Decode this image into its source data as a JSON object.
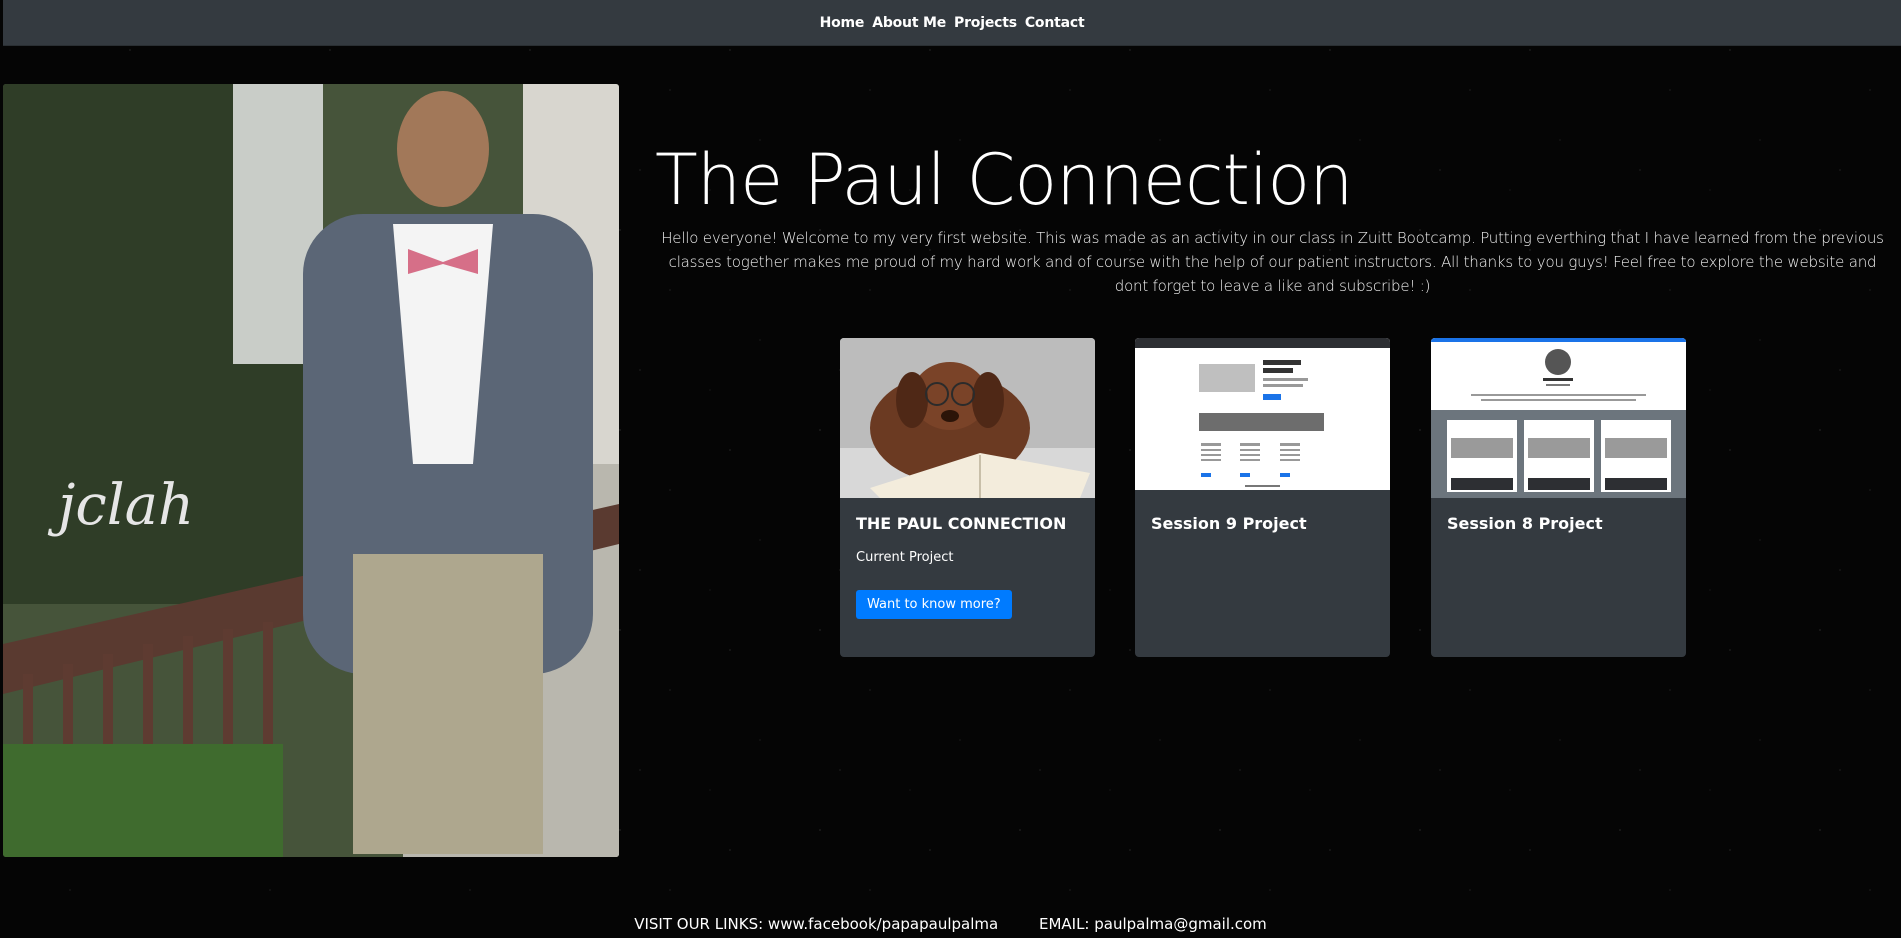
{
  "nav": {
    "items": [
      {
        "label": "Home"
      },
      {
        "label": "About Me"
      },
      {
        "label": "Projects"
      },
      {
        "label": "Contact"
      }
    ]
  },
  "hero": {
    "title": "The Paul Connection",
    "intro": "Hello everyone! Welcome to my very first website. This was made as an activity in our class in Zuitt Bootcamp. Putting everthing that I have learned from the previous classes together makes me proud of my hard work and of course with the help of our patient instructors. All thanks to you guys! Feel free to explore the website and dont forget to leave a like and subscribe! :)",
    "photo_icon": "profile-photo"
  },
  "projects": [
    {
      "title": "THE PAUL CONNECTION",
      "subtitle": "Current Project",
      "button": "Want to know more?",
      "image_icon": "puppy-image"
    },
    {
      "title": "Session 9 Project",
      "image_icon": "session9-screenshot"
    },
    {
      "title": "Session 8 Project",
      "image_icon": "session8-screenshot"
    }
  ],
  "footer": {
    "links": "VISIT OUR LINKS: www.facebook/papapaulpalma",
    "email": "EMAIL: paulpalma@gmail.com"
  },
  "colors": {
    "navbar": "#343a40",
    "card": "#343a40",
    "button": "#007bff",
    "background": "#050505"
  }
}
